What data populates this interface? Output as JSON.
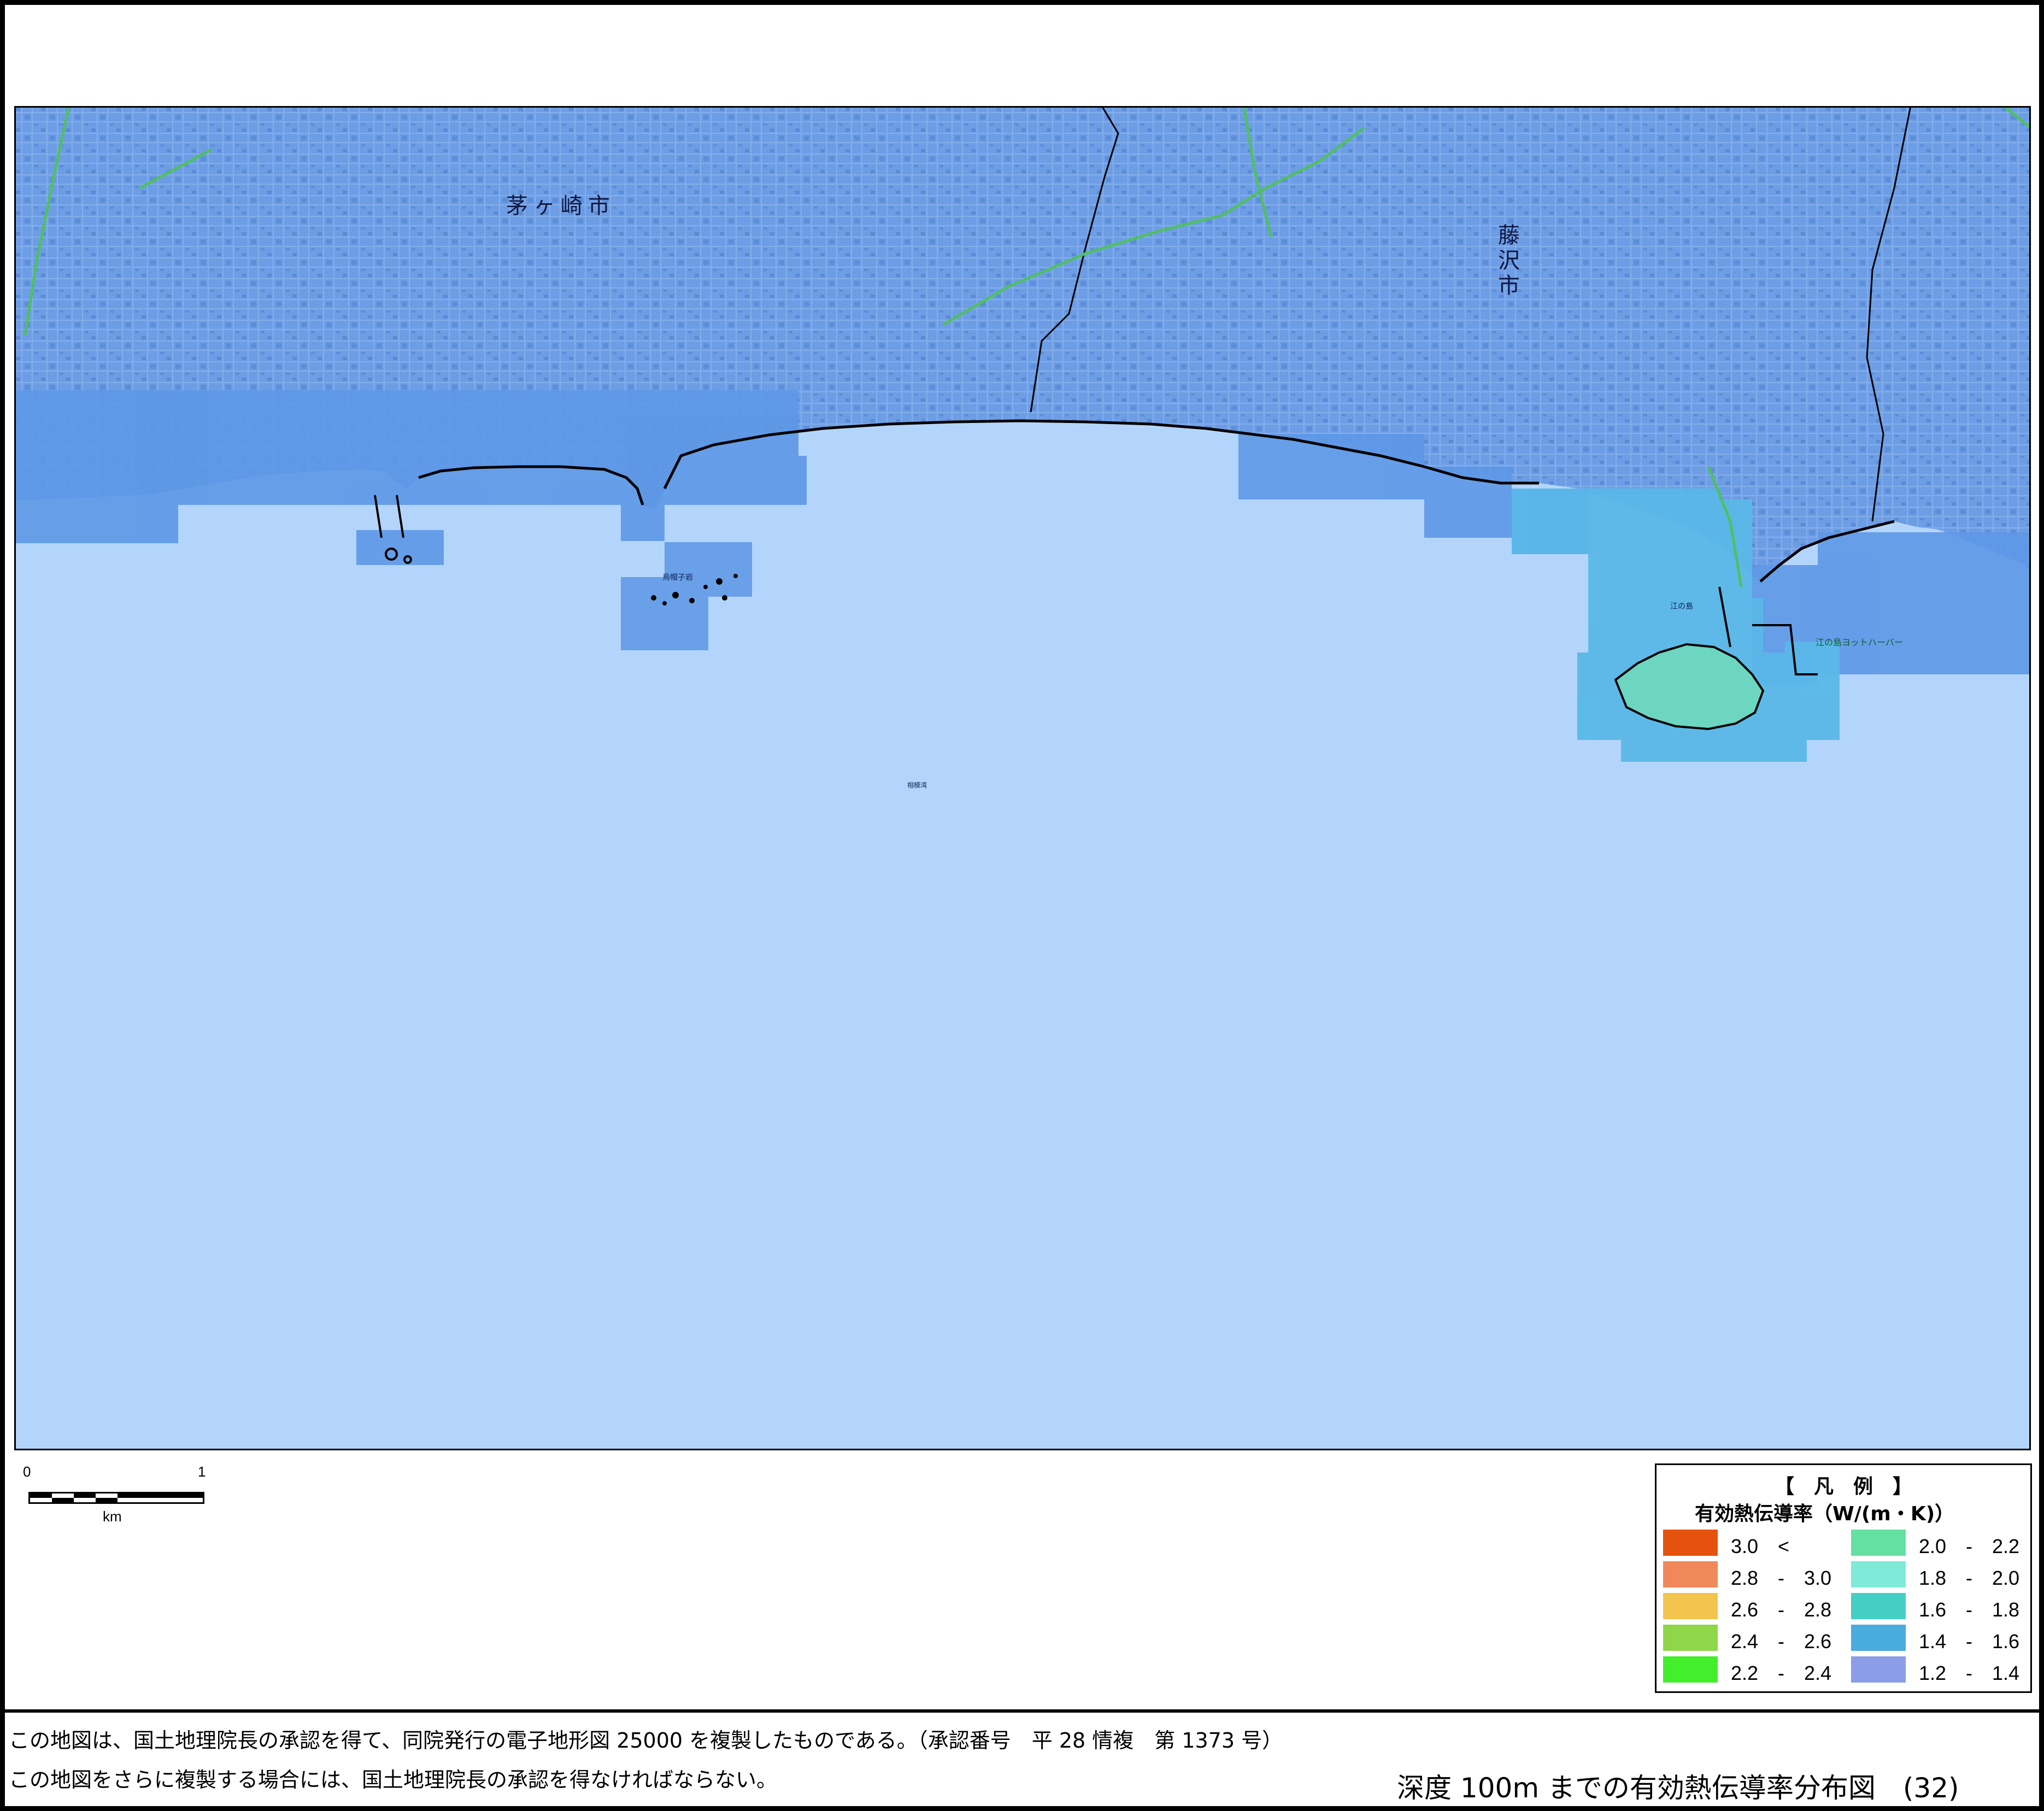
{
  "map": {
    "place_labels": {
      "chigasaki": "茅ヶ崎市",
      "fujisawa": "藤沢市",
      "enoshima": "江の島",
      "eboshi_rock": "烏帽子岩",
      "yacht_harbor": "江の島ヨットハーバー",
      "sagami_bay": "相模湾"
    },
    "colors": {
      "sea": "#b4d5fb",
      "land": "#6f9fe6",
      "coast_cells": "#4a90e0",
      "enoshima_cells": "#5ab8e8",
      "coast_line": "#000000",
      "rail": "#4fc060"
    }
  },
  "scale_bar": {
    "tick_start": "0",
    "tick_end": "1",
    "unit": "km"
  },
  "legend": {
    "title": "【　凡　例　】",
    "subtitle": "有効熱伝導率（W/(m・K)）",
    "items_left": [
      {
        "range": "3.0　<",
        "color": "#e5520d"
      },
      {
        "range": "2.8　-　3.0",
        "color": "#f0885a"
      },
      {
        "range": "2.6　-　2.8",
        "color": "#f3c44e"
      },
      {
        "range": "2.4　-　2.6",
        "color": "#8fd649"
      },
      {
        "range": "2.2　-　2.4",
        "color": "#43ee2b"
      }
    ],
    "items_right": [
      {
        "range": "2.0　-　2.2",
        "color": "#64e0a2"
      },
      {
        "range": "1.8　-　2.0",
        "color": "#7eead7"
      },
      {
        "range": "1.6　-　1.8",
        "color": "#43cfc4"
      },
      {
        "range": "1.4　-　1.6",
        "color": "#48acdf"
      },
      {
        "range": "1.2　-　1.4",
        "color": "#8b9ce8"
      }
    ]
  },
  "footer": {
    "credit_line1": "この地図は、国土地理院長の承認を得て、同院発行の電子地形図 25000 を複製したものである。（承認番号　平 28 情複　第 1373 号）",
    "credit_line2": "この地図をさらに複製する場合には、国土地理院長の承認を得なければならない。",
    "title": "深度 100m までの有効熱伝導率分布図　(32)"
  }
}
